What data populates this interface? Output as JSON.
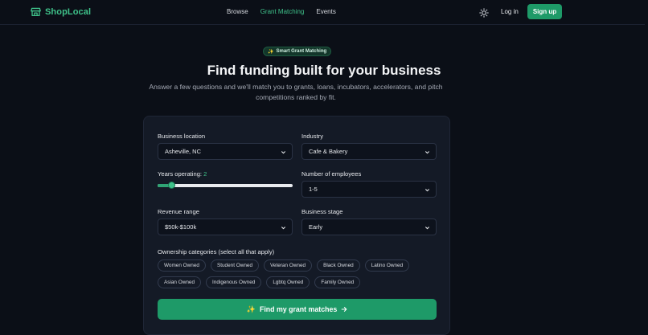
{
  "nav": {
    "brand": "ShopLocal",
    "links": [
      {
        "label": "Browse",
        "active": false
      },
      {
        "label": "Grant Matching",
        "active": true
      },
      {
        "label": "Events",
        "active": false
      }
    ],
    "theme_icon": "sun-icon",
    "login": "Log in",
    "signup": "Sign up"
  },
  "hero": {
    "badge": "Smart Grant Matching",
    "badge_icon": "sparkle-icon",
    "title": "Find funding built for your business",
    "subtitle": "Answer a few questions and we'll match you to grants, loans, incubators, accelerators, and pitch competitions ranked by fit."
  },
  "form": {
    "location": {
      "label": "Business location",
      "value": "Asheville, NC"
    },
    "industry": {
      "label": "Industry",
      "value": "Cafe & Bakery"
    },
    "years": {
      "label": "Years operating: ",
      "value": "2",
      "min": 0,
      "max": 30,
      "level": 0.1
    },
    "employees": {
      "label": "Number of employees",
      "value": "1-5"
    },
    "revenue": {
      "label": "Revenue range",
      "value": "$50k-$100k"
    },
    "stage": {
      "label": "Business stage",
      "value": "Early"
    },
    "ownership": {
      "label": "Ownership categories (select all that apply)",
      "options": [
        "Women Owned",
        "Student Owned",
        "Veteran Owned",
        "Black Owned",
        "Latino Owned",
        "Asian Owned",
        "Indigenous Owned",
        "Lgbtq Owned",
        "Family Owned"
      ]
    },
    "submit": "Find my grant matches",
    "submit_icon": "sparkle-icon",
    "submit_arrow": "arrow-right-icon"
  },
  "colors": {
    "accent": "#3fc28a",
    "button": "#1e9a68",
    "background": "#0b0f17",
    "card": "#141a26"
  }
}
